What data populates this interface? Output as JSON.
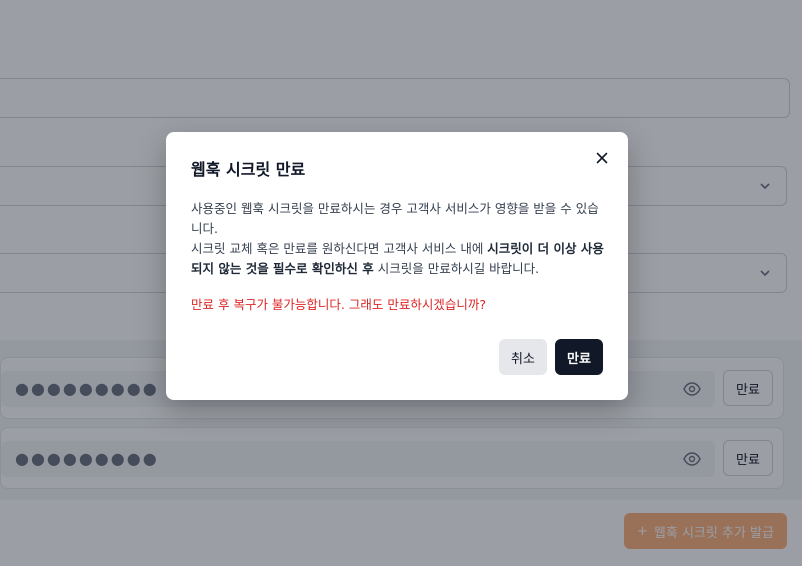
{
  "background": {
    "secrets": [
      {
        "masked_value": "●●●●●●●●●",
        "expire_label": "만료"
      },
      {
        "masked_value": "●●●●●●●●●",
        "expire_label": "만료"
      }
    ],
    "add_button_icon": "+",
    "add_button_label": "웹훅 시크릿 추가 발급"
  },
  "modal": {
    "title": "웹훅 시크릿 만료",
    "close_icon": "×",
    "body_line1": "사용중인 웹훅 시크릿을 만료하시는 경우 고객사 서비스가 영향을 받을 수 있습니다.",
    "body_line2_pre": "시크릿 교체 혹은 만료를 원하신다면 고객사 서비스 내에 ",
    "body_line2_bold": "시크릿이 더 이상 사용되지 않는 것을 필수로 확인하신 후",
    "body_line2_post": " 시크릿을 만료하시길 바랍니다.",
    "warning": "만료 후 복구가 불가능합니다. 그래도 만료하시겠습니까?",
    "cancel_label": "취소",
    "confirm_label": "만료"
  },
  "colors": {
    "accent_orange": "#f97316",
    "danger_red": "#dc2626",
    "primary_dark": "#111827"
  }
}
